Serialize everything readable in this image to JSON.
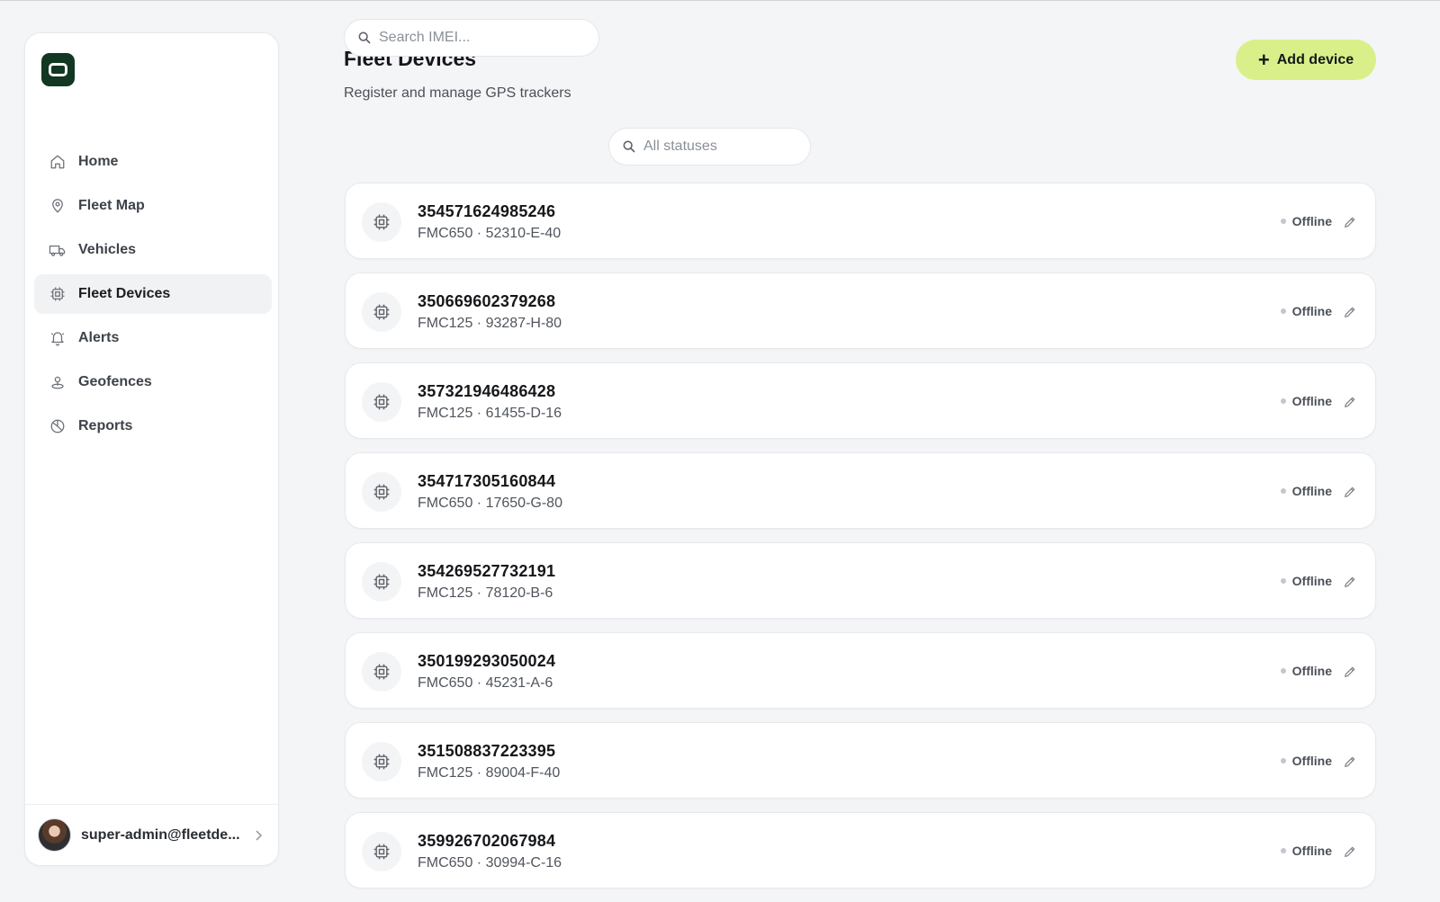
{
  "sidebar": {
    "items": [
      {
        "id": "home",
        "label": "Home",
        "icon": "home-icon",
        "active": false
      },
      {
        "id": "fleet-map",
        "label": "Fleet Map",
        "icon": "map-pin-icon",
        "active": false
      },
      {
        "id": "vehicles",
        "label": "Vehicles",
        "icon": "truck-icon",
        "active": false
      },
      {
        "id": "fleet-devices",
        "label": "Fleet Devices",
        "icon": "chip-icon",
        "active": true
      },
      {
        "id": "alerts",
        "label": "Alerts",
        "icon": "bell-icon",
        "active": false
      },
      {
        "id": "geofences",
        "label": "Geofences",
        "icon": "geofence-pin-icon",
        "active": false
      },
      {
        "id": "reports",
        "label": "Reports",
        "icon": "pie-chart-icon",
        "active": false
      }
    ],
    "user": {
      "email": "super-admin@fleetde..."
    }
  },
  "header": {
    "title": "Fleet Devices",
    "subtitle": "Register and manage GPS trackers",
    "add_label": "Add device"
  },
  "filters": {
    "search_placeholder": "Search IMEI...",
    "status_label": "All statuses"
  },
  "devices": [
    {
      "imei": "354571624985246",
      "meta": "FMC650 · 52310-E-40",
      "status": "Offline"
    },
    {
      "imei": "350669602379268",
      "meta": "FMC125 · 93287-H-80",
      "status": "Offline"
    },
    {
      "imei": "357321946486428",
      "meta": "FMC125 · 61455-D-16",
      "status": "Offline"
    },
    {
      "imei": "354717305160844",
      "meta": "FMC650 · 17650-G-80",
      "status": "Offline"
    },
    {
      "imei": "354269527732191",
      "meta": "FMC125 · 78120-B-6",
      "status": "Offline"
    },
    {
      "imei": "350199293050024",
      "meta": "FMC650 · 45231-A-6",
      "status": "Offline"
    },
    {
      "imei": "351508837223395",
      "meta": "FMC125 · 89004-F-40",
      "status": "Offline"
    },
    {
      "imei": "359926702067984",
      "meta": "FMC650 · 30994-C-16",
      "status": "Offline"
    }
  ],
  "colors": {
    "accent": "#d9f08a",
    "logo_bg": "#123722",
    "status_offline": "#c3c7cc"
  }
}
